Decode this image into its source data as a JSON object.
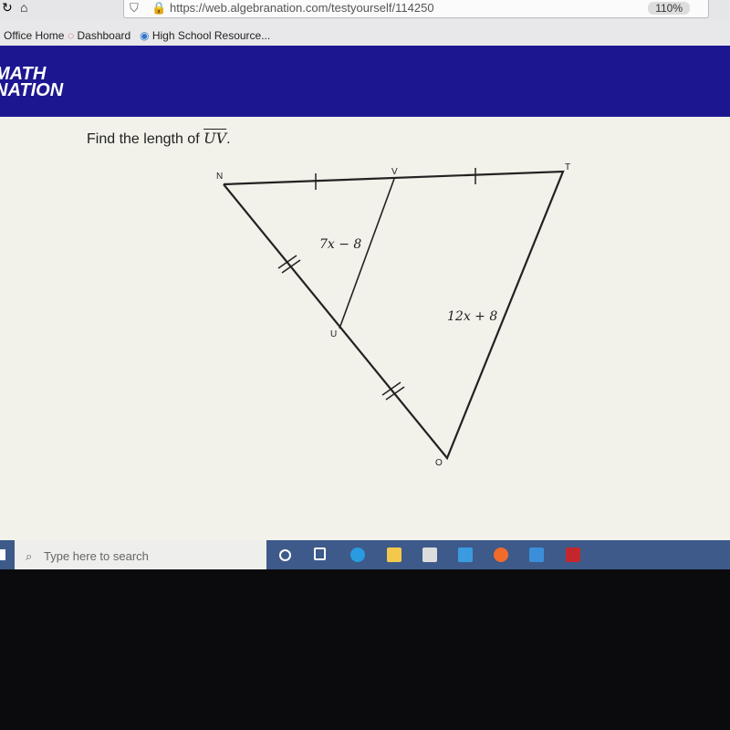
{
  "browser": {
    "url": "https://web.algebranation.com/testyourself/114250",
    "zoom": "110%",
    "bookmarks": [
      "Office Home",
      "Dashboard",
      "High School Resource..."
    ]
  },
  "header": {
    "logo": "MATH NATION"
  },
  "question": {
    "prefix": "Find the length of ",
    "segment": "UV",
    "suffix": "."
  },
  "figure": {
    "points": {
      "N": "N",
      "V": "V",
      "T": "T",
      "U": "U",
      "O": "O"
    },
    "label_uv": "7x − 8",
    "label_ot": "12x + 8"
  },
  "taskbar": {
    "search_placeholder": "Type here to search",
    "icons": [
      "cortana-icon",
      "task-view-icon",
      "edge-icon",
      "file-explorer-icon",
      "store-icon",
      "mail-icon",
      "firefox-icon",
      "photos-icon",
      "acrobat-icon"
    ]
  }
}
